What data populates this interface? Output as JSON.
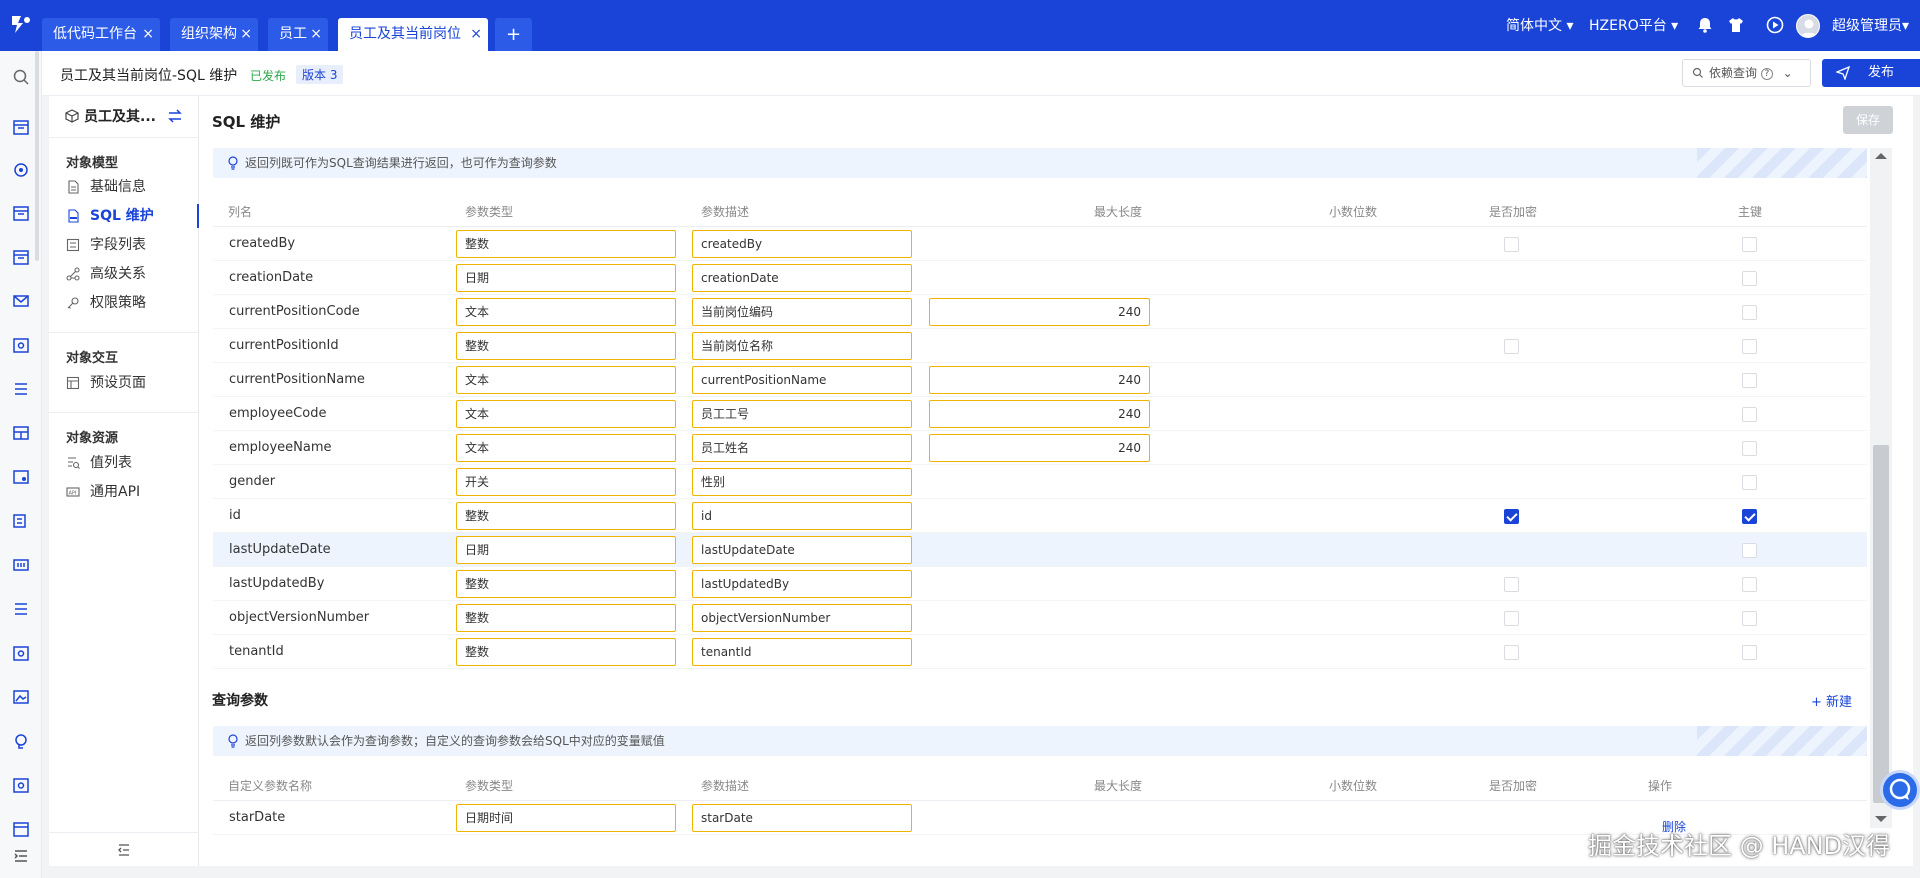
{
  "topbar": {
    "tabs": [
      {
        "label": "低代码工作台",
        "close": "×"
      },
      {
        "label": "组织架构",
        "close": "×"
      },
      {
        "label": "员工",
        "close": "×"
      },
      {
        "label": "员工及其当前岗位",
        "close": "×"
      },
      {
        "label": "+"
      }
    ],
    "language": "简体中文",
    "platform": "HZERO平台",
    "user": "超级管理员"
  },
  "header": {
    "title": "员工及其当前岗位-SQL 维护",
    "status": "已发布",
    "version": "版本 3",
    "dependency_query": "依赖查询",
    "publish": "发布"
  },
  "objnav": {
    "object_name": "员工及其...",
    "groups": [
      {
        "title": "对象模型",
        "items": [
          "基础信息",
          "SQL 维护",
          "字段列表",
          "高级关系",
          "权限策略"
        ]
      },
      {
        "title": "对象交互",
        "items": [
          "预设页面"
        ]
      },
      {
        "title": "对象资源",
        "items": [
          "值列表",
          "通用API"
        ]
      }
    ],
    "active_item": "SQL 维护"
  },
  "sql": {
    "title": "SQL 维护",
    "save": "保存",
    "tip": "返回列既可作为SQL查询结果进行返回，也可作为查询参数",
    "headers": [
      "列名",
      "参数类型",
      "参数描述",
      "最大长度",
      "小数位数",
      "是否加密",
      "主键"
    ],
    "rows": [
      {
        "name": "createdBy",
        "type": "整数",
        "desc": "createdBy",
        "maxlen": "",
        "encrypt": false,
        "pk": false
      },
      {
        "name": "creationDate",
        "type": "日期",
        "desc": "creationDate",
        "maxlen": "",
        "encrypt": null,
        "pk": false
      },
      {
        "name": "currentPositionCode",
        "type": "文本",
        "desc": "当前岗位编码",
        "maxlen": "240",
        "encrypt": null,
        "pk": false
      },
      {
        "name": "currentPositionId",
        "type": "整数",
        "desc": "当前岗位名称",
        "maxlen": "",
        "encrypt": false,
        "pk": false
      },
      {
        "name": "currentPositionName",
        "type": "文本",
        "desc": "currentPositionName",
        "maxlen": "240",
        "encrypt": null,
        "pk": false
      },
      {
        "name": "employeeCode",
        "type": "文本",
        "desc": "员工工号",
        "maxlen": "240",
        "encrypt": null,
        "pk": false
      },
      {
        "name": "employeeName",
        "type": "文本",
        "desc": "员工姓名",
        "maxlen": "240",
        "encrypt": null,
        "pk": false
      },
      {
        "name": "gender",
        "type": "开关",
        "desc": "性别",
        "maxlen": "",
        "encrypt": null,
        "pk": false
      },
      {
        "name": "id",
        "type": "整数",
        "desc": "id",
        "maxlen": "",
        "encrypt": true,
        "pk": true
      },
      {
        "name": "lastUpdateDate",
        "type": "日期",
        "desc": "lastUpdateDate",
        "maxlen": "",
        "encrypt": null,
        "pk": false
      },
      {
        "name": "lastUpdatedBy",
        "type": "整数",
        "desc": "lastUpdatedBy",
        "maxlen": "",
        "encrypt": false,
        "pk": false
      },
      {
        "name": "objectVersionNumber",
        "type": "整数",
        "desc": "objectVersionNumber",
        "maxlen": "",
        "encrypt": false,
        "pk": false
      },
      {
        "name": "tenantId",
        "type": "整数",
        "desc": "tenantId",
        "maxlen": "",
        "encrypt": false,
        "pk": false
      }
    ]
  },
  "query": {
    "title": "查询参数",
    "new": "+ 新建",
    "tip": "返回列参数默认会作为查询参数；自定义的查询参数会给SQL中对应的变量赋值",
    "headers": [
      "自定义参数名称",
      "参数类型",
      "参数描述",
      "最大长度",
      "小数位数",
      "是否加密",
      "操作"
    ],
    "rows": [
      {
        "name": "starDate",
        "type": "日期时间",
        "desc": "starDate",
        "action": "删除"
      }
    ]
  },
  "watermark": "掘金技术社区 @ HAND汉得",
  "colors": {
    "brand": "#1a44d8",
    "field_border": "#f0b400",
    "published": "#2ba84a"
  }
}
